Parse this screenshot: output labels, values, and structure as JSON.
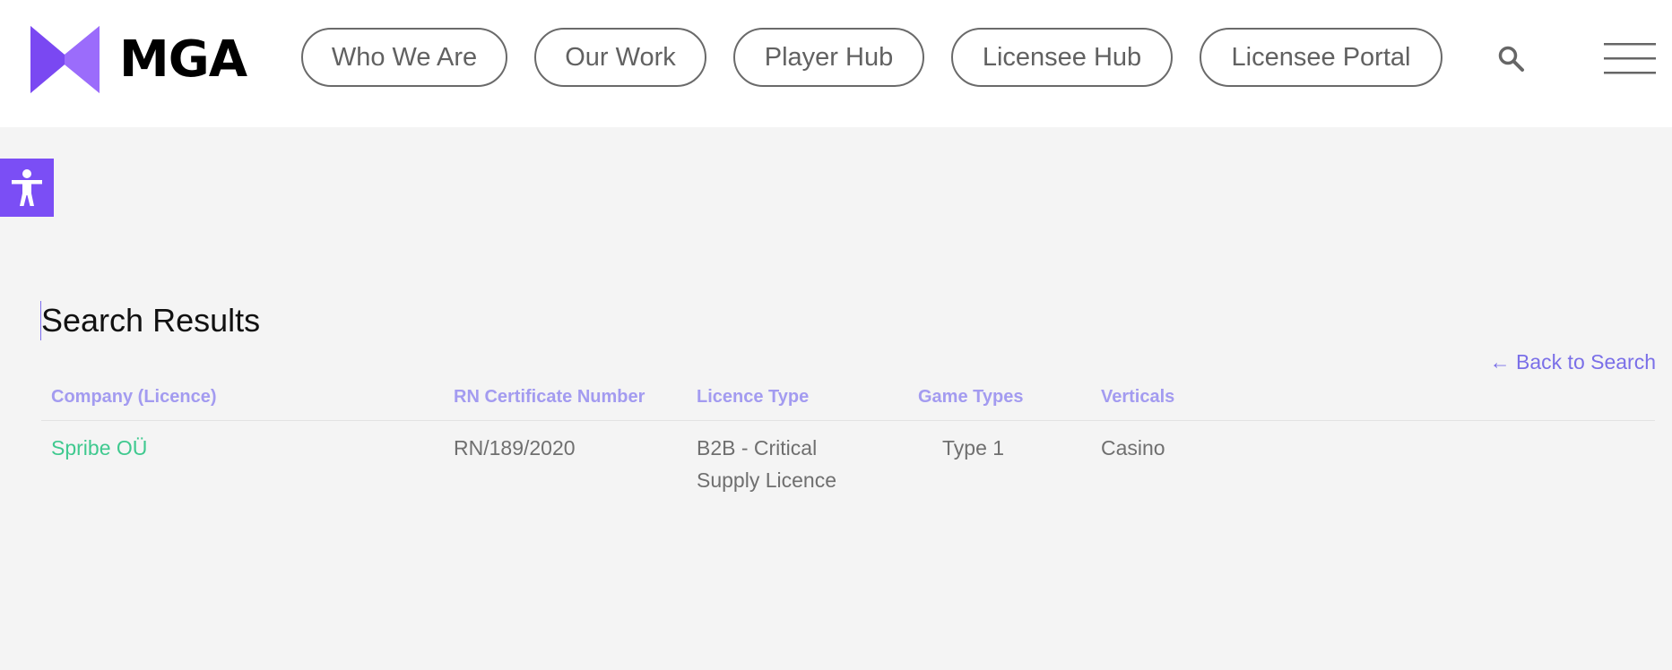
{
  "header": {
    "logo_text": "MGA",
    "brand_color": "#7b4ef5",
    "nav": [
      {
        "label": "Who We Are"
      },
      {
        "label": "Our Work"
      },
      {
        "label": "Player Hub"
      },
      {
        "label": "Licensee Hub"
      },
      {
        "label": "Licensee Portal"
      }
    ],
    "search_icon": "search-icon",
    "menu_icon": "hamburger-menu-icon"
  },
  "accessibility": {
    "icon": "accessibility-person-icon"
  },
  "main": {
    "title": "Search Results",
    "back_link": "← Back to Search",
    "table": {
      "columns": [
        "Company (Licence)",
        "RN Certificate Number",
        "Licence Type",
        "Game Types",
        "Verticals"
      ],
      "rows": [
        {
          "company": "Spribe OÜ",
          "rn_certificate": "RN/189/2020",
          "licence_type": "B2B - Critical Supply Licence",
          "game_types": "Type 1",
          "verticals": "Casino"
        }
      ]
    }
  },
  "colors": {
    "header_text": "#a39bf0",
    "company_link": "#3fc98f",
    "back_link": "#7a6fe8"
  }
}
